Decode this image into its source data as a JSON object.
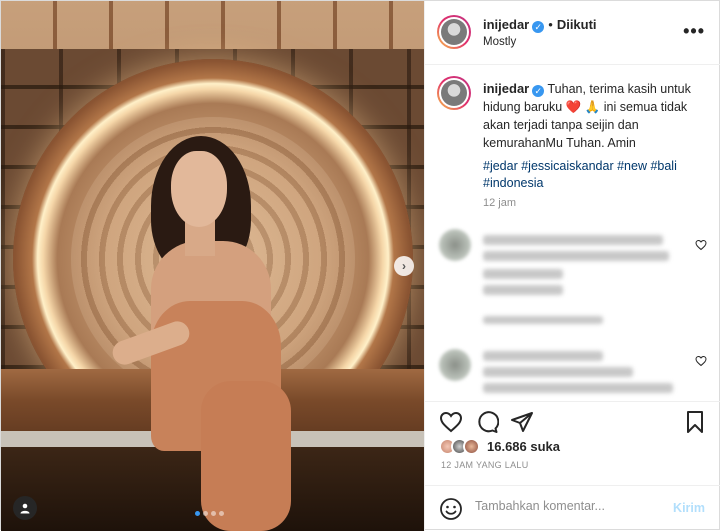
{
  "post": {
    "author": "inijedar",
    "header_separator": "•",
    "follow_label": "Diikuti",
    "location": "Mostly",
    "more_label": "•••",
    "caption": "Tuhan, terima kasih untuk hidung baruku ❤️ 🙏 ini semua tidak akan terjadi tanpa seijin dan kemurahanMu Tuhan. Amin",
    "hashtags": "#jedar #jessicaiskandar #new #bali #indonesia",
    "caption_time": "12 jam",
    "likes_count": "16.686",
    "likes_suffix": "suka",
    "timestamp": "12 JAM YANG LALU"
  },
  "media": {
    "carousel_dots": 4,
    "active_dot": 0,
    "next_arrow": "›"
  },
  "comment_box": {
    "placeholder": "Tambahkan komentar...",
    "send_label": "Kirim"
  },
  "icons": {
    "verified": "verified-badge-icon",
    "more": "more-options-icon",
    "like": "heart-icon",
    "comment": "comment-icon",
    "share": "share-icon",
    "save": "bookmark-icon",
    "emoji": "emoji-icon",
    "user_tag": "user-tag-icon",
    "next": "chevron-right-icon"
  },
  "colors": {
    "link": "#00376b",
    "verified": "#3897f0",
    "muted": "#8e8e8e",
    "send_disabled": "#b2dffc"
  }
}
